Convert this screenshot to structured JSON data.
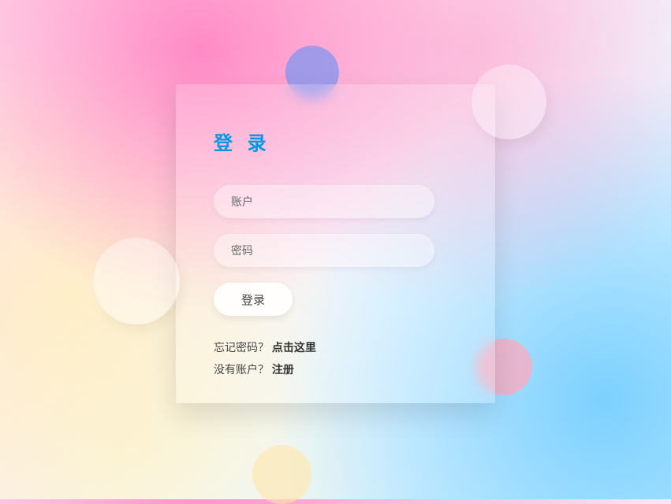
{
  "login": {
    "title": "登 录",
    "accountPlaceholder": "账户",
    "passwordPlaceholder": "密码",
    "submitLabel": "登录",
    "forgotText": "忘记密码？",
    "forgotLink": "点击这里",
    "noAccountText": "没有账户？",
    "registerLink": "注册"
  }
}
